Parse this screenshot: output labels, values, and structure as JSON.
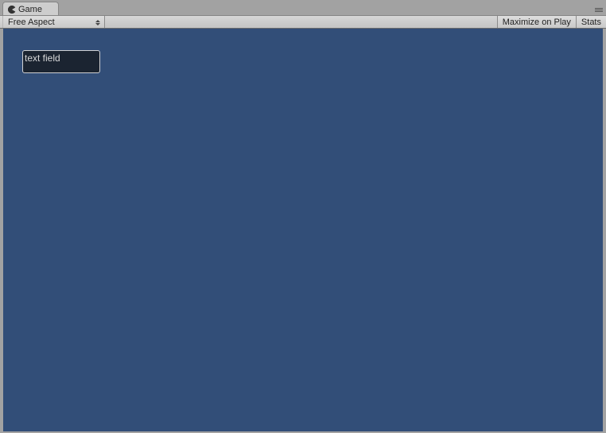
{
  "tab": {
    "label": "Game"
  },
  "toolbar": {
    "aspect": "Free Aspect",
    "maximize": "Maximize on Play",
    "stats": "Stats"
  },
  "viewport": {
    "text_field": {
      "value": "text field"
    }
  }
}
